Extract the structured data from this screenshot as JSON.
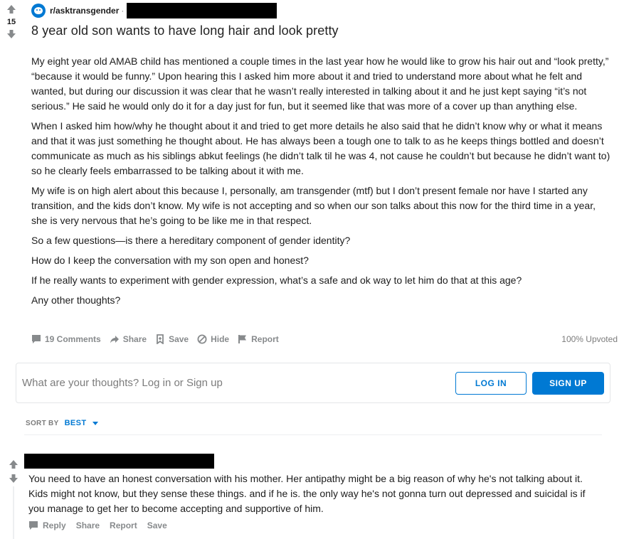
{
  "post": {
    "subreddit": "r/asktransgender",
    "separator": "·",
    "score": "15",
    "title": "8 year old son wants to have long hair and look pretty",
    "paragraphs": [
      "My eight year old AMAB child has mentioned a couple times in the last year how he would like to grow his hair out and “look pretty,” “because it would be funny.” Upon hearing this I asked him more about it and tried to understand more about what he felt and wanted, but during our discussion it was clear that he wasn’t really interested in talking about it and he just kept saying “it’s not serious.” He said he would only do it for a day just for fun, but it seemed like that was more of a cover up than anything else.",
      "When I asked him how/why he thought about it and tried to get more details he also said that he didn’t know why or what it means and that it was just something he thought about. He has always been a tough one to talk to as he keeps things bottled and doesn’t communicate as much as his siblings abkut feelings (he didn’t talk til he was 4, not cause he couldn’t but because he didn’t want to) so he clearly feels embarrassed to be talking about it with me.",
      "My wife is on high alert about this because I, personally, am transgender (mtf) but I don’t present female nor have I started any transition, and the kids don’t know. My wife is not accepting and so when our son talks about this now for the third time in a year, she is very nervous that he’s going to be like me in that respect.",
      "So a few questions—is there a hereditary component of gender identity?",
      "How do I keep the conversation with my son open and honest?",
      "If he really wants to experiment with gender expression, what’s a safe and ok way to let him do that at this age?",
      "Any other thoughts?"
    ],
    "actions": {
      "comments": "19 Comments",
      "share": "Share",
      "save": "Save",
      "hide": "Hide",
      "report": "Report"
    },
    "upvoted": "100% Upvoted"
  },
  "comment_box": {
    "prompt": "What are your thoughts? Log in or Sign up",
    "login": "LOG IN",
    "signup": "SIGN UP"
  },
  "sort": {
    "label": "SORT BY",
    "value": "BEST"
  },
  "comment": {
    "text": "You need to have an honest conversation with his mother. Her antipathy might be a big reason of why he's not talking about it. Kids might not know, but they sense these things. and if he is. the only way he's not gonna turn out depressed and suicidal is if you manage to get her to become accepting and supportive of him.",
    "actions": {
      "reply": "Reply",
      "share": "Share",
      "report": "Report",
      "save": "Save"
    }
  },
  "colors": {
    "accent": "#0079d3",
    "muted": "#878a8c",
    "text": "#1c1c1c"
  }
}
